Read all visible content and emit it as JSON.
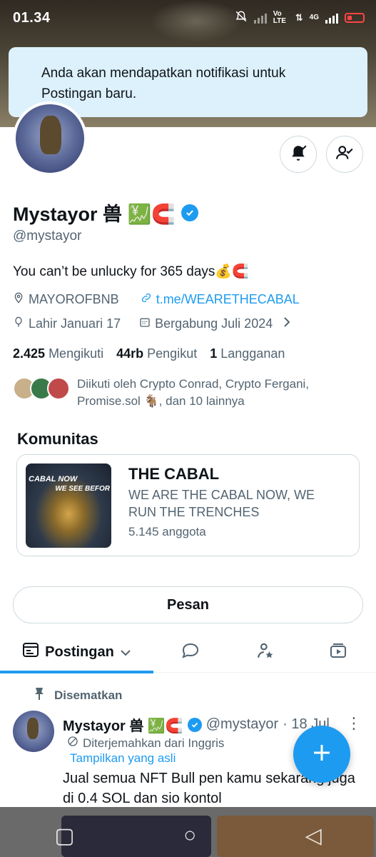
{
  "status_bar": {
    "time": "01.34",
    "volte": "Vo LTE",
    "network": "4G"
  },
  "toast": {
    "message": "Anda akan mendapatkan notifikasi untuk Postingan baru."
  },
  "profile": {
    "name": "Mystayor 兽 💹🧲",
    "handle": "@mystayor",
    "bio": "You can’t be unlucky for 365 days💰🧲",
    "location": "MAYOROFBNB",
    "link": "t.me/WEARETHECABAL",
    "birthday": "Lahir Januari 17",
    "joined": "Bergabung Juli 2024",
    "following_count": "2.425",
    "following_label": "Mengikuti",
    "followers_count": "44rb",
    "followers_label": "Pengikut",
    "subs_count": "1",
    "subs_label": "Langganan",
    "followed_by": "Diikuti oleh Crypto Conrad, Crypto Fergani, Promise.sol 🐐, dan 10 lainnya"
  },
  "community": {
    "section_title": "Komunitas",
    "name": "THE CABAL",
    "description": "WE ARE THE CABAL NOW, WE RUN THE TRENCHES",
    "members": "5.145 anggota",
    "image_text_1": "CABAL NOW",
    "image_text_2": "WE SEE BEFOR"
  },
  "message_button": "Pesan",
  "tabs": {
    "active_label": "Postingan"
  },
  "post": {
    "pinned_label": "Disematkan",
    "author_name": "Mystayor 兽 💹🧲",
    "author_handle": "@mystayor",
    "date": "· 18 Jul",
    "translated_label": "Diterjemahkan dari Inggris",
    "show_original": "Tampilkan yang asli",
    "text": "Jual semua NFT Bull pen kamu sekarang juga di 0.4 SOL dan sio kontol"
  },
  "colors": {
    "accent": "#1d9bf0",
    "toast_bg": "#dcf1fb",
    "secondary_text": "#536471"
  }
}
